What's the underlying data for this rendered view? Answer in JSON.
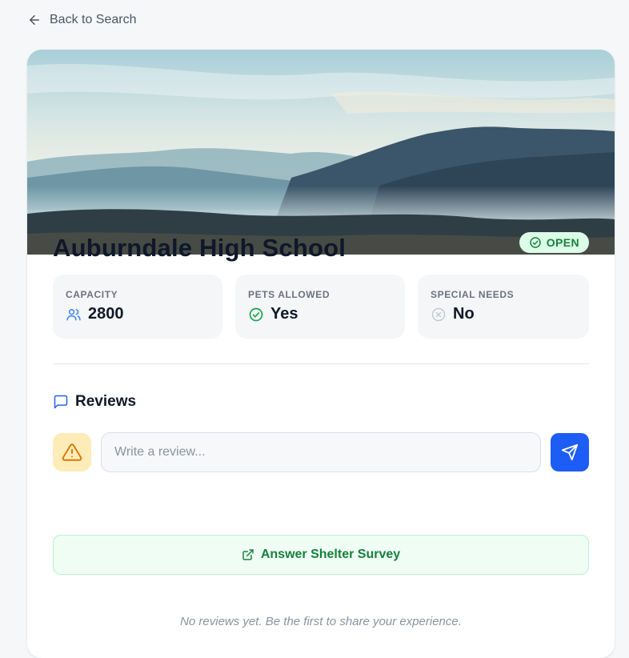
{
  "nav": {
    "back_label": "Back to Search"
  },
  "shelter": {
    "name": "Auburndale High School",
    "status": "OPEN",
    "status_color": "#15803d"
  },
  "stats": [
    {
      "label": "CAPACITY",
      "value": "2800",
      "icon": "users-icon"
    },
    {
      "label": "PETS ALLOWED",
      "value": "Yes",
      "icon": "check-circle-icon"
    },
    {
      "label": "SPECIAL NEEDS",
      "value": "No",
      "icon": "x-circle-icon"
    }
  ],
  "reviews": {
    "heading": "Reviews",
    "input_placeholder": "Write a review...",
    "input_value": "",
    "survey_label": "Answer Shelter Survey",
    "empty_text": "No reviews yet. Be the first to share your experience."
  },
  "colors": {
    "accent": "#1d5cf5",
    "success_bg": "#dcfce7",
    "warning_bg": "#fdecb7",
    "warning": "#d97706"
  }
}
